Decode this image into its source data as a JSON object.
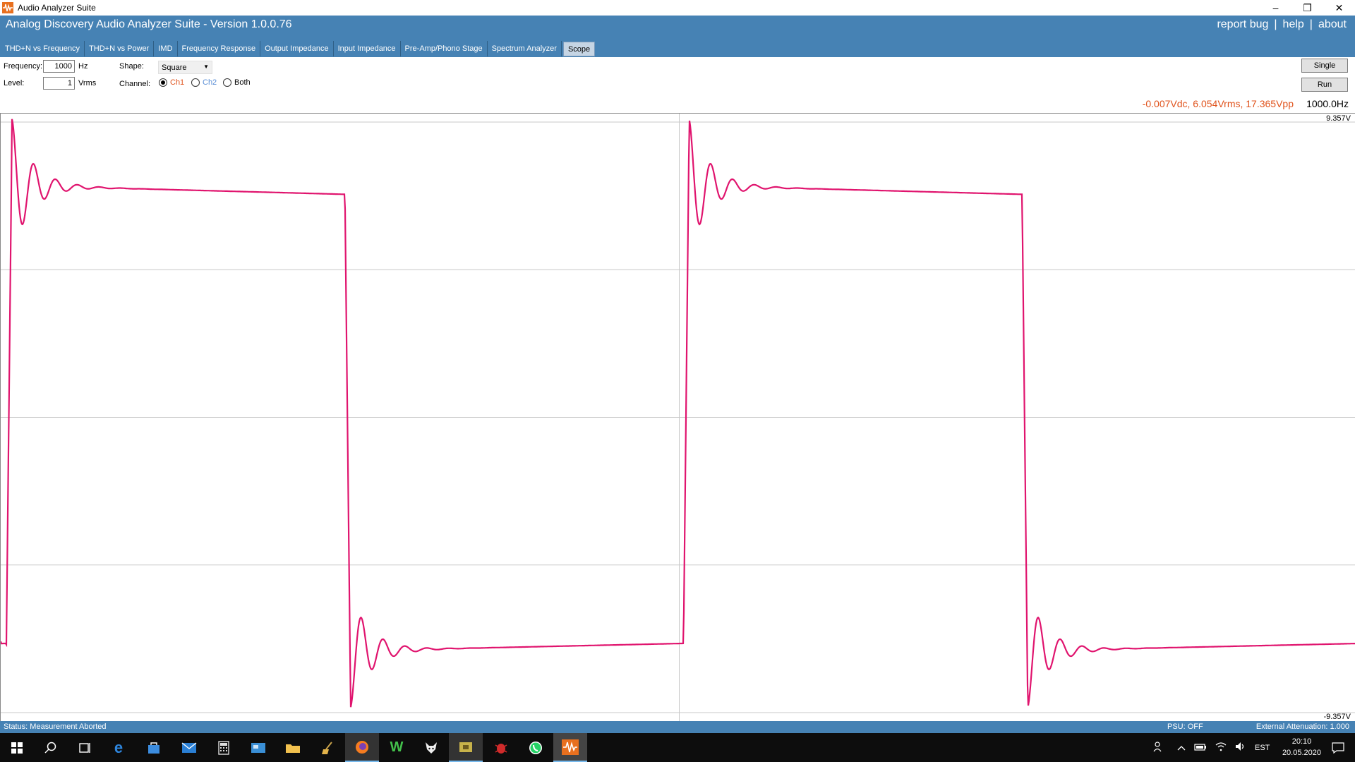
{
  "window": {
    "title": "Audio Analyzer Suite",
    "minimize_glyph": "–",
    "restore_glyph": "❐",
    "close_glyph": "✕"
  },
  "header": {
    "app_title": "Analog Discovery Audio Analyzer Suite - Version   1.0.0.76",
    "links": [
      "report bug",
      "help",
      "about"
    ],
    "separator": "|"
  },
  "tabs": [
    "THD+N vs Frequency",
    "THD+N vs Power",
    "IMD",
    "Frequency Response",
    "Output Impedance",
    "Input Impedance",
    "Pre-Amp/Phono Stage",
    "Spectrum Analyzer",
    "Scope"
  ],
  "active_tab": "Scope",
  "controls": {
    "frequency_label": "Frequency:",
    "frequency_value": "1000",
    "frequency_unit": "Hz",
    "level_label": "Level:",
    "level_value": "1",
    "level_unit": "Vrms",
    "shape_label": "Shape:",
    "shape_value": "Square",
    "channel_label": "Channel:",
    "channel_options": [
      "Ch1",
      "Ch2",
      "Both"
    ],
    "channel_selected": "Ch1",
    "single_button": "Single",
    "run_button": "Run"
  },
  "readout": {
    "values": "-0.007Vdc, 6.054Vrms, 17.365Vpp",
    "frequency": "1000.0Hz"
  },
  "scope": {
    "y_max_label": "9.357V",
    "y_min_label": "-9.357V",
    "trace_color": "#e0146e",
    "grid_color": "#c8c8c8"
  },
  "chart_data": {
    "type": "line",
    "title": "",
    "xlabel": "",
    "ylabel": "",
    "ylim": [
      -9.357,
      9.357
    ],
    "series": [
      {
        "waveform": "square with overshoot ringing",
        "high_level_v": 7.1,
        "low_level_v": -7.2,
        "peak_max_v": 9.2,
        "peak_min_v": -9.0,
        "cycles_shown": 2
      }
    ]
  },
  "status": {
    "text": "Status: Measurement Aborted",
    "psu": "PSU: OFF",
    "attenuation": "External Attenuation: 1.000"
  },
  "taskbar": {
    "icons": [
      "windows-start-icon",
      "search-icon",
      "task-view-icon",
      "edge-icon",
      "store-icon",
      "mail-icon",
      "calculator-icon",
      "control-panel-icon",
      "file-explorer-icon",
      "cleaner-icon",
      "firefox-icon",
      "w-app-icon",
      "fox-app-icon",
      "archive-app-icon",
      "bug-app-icon",
      "whatsapp-icon",
      "audio-analyzer-icon"
    ],
    "language": "EST",
    "time": "20:10",
    "date": "20.05.2020"
  }
}
